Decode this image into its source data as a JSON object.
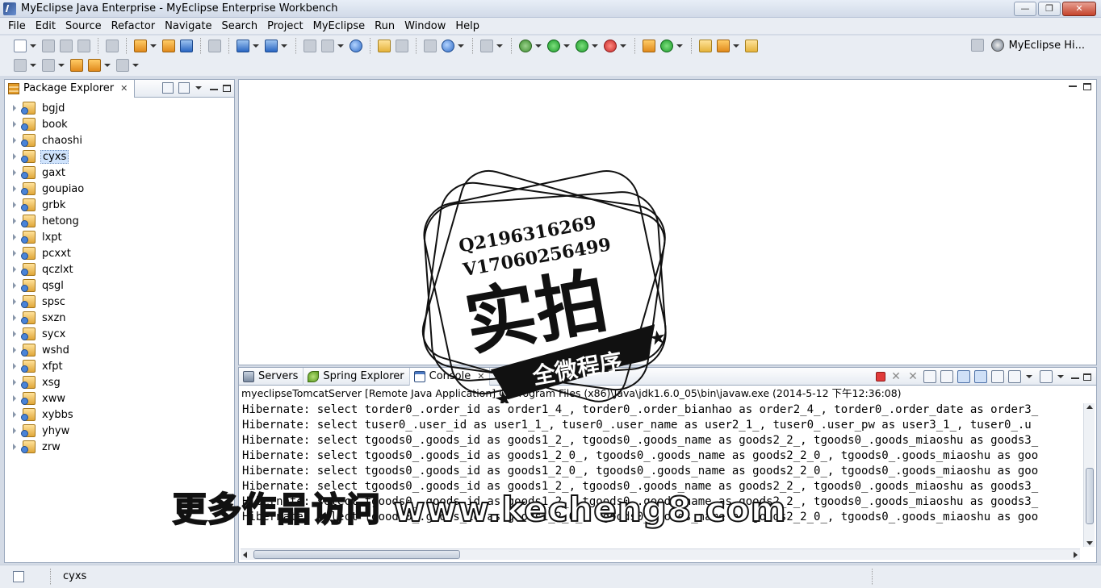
{
  "window": {
    "title": "MyEclipse Java Enterprise - MyEclipse Enterprise Workbench",
    "minimize": "—",
    "restore": "❐",
    "close": "✕"
  },
  "menu": [
    "File",
    "Edit",
    "Source",
    "Refactor",
    "Navigate",
    "Search",
    "Project",
    "MyEclipse",
    "Run",
    "Window",
    "Help"
  ],
  "perspective": {
    "label": "MyEclipse Hi..."
  },
  "package_explorer": {
    "title": "Package Explorer",
    "close": "✕",
    "projects": [
      "bgjd",
      "book",
      "chaoshi",
      "cyxs",
      "gaxt",
      "goupiao",
      "grbk",
      "hetong",
      "lxpt",
      "pcxxt",
      "qczlxt",
      "qsgl",
      "spsc",
      "sxzn",
      "sycx",
      "wshd",
      "xfpt",
      "xsg",
      "xww",
      "xybbs",
      "yhyw",
      "zrw"
    ],
    "selected": "cyxs"
  },
  "bottom_tabs": {
    "servers": "Servers",
    "spring": "Spring Explorer",
    "console": "Console",
    "close": "✕"
  },
  "console": {
    "header": "myeclipseTomcatServer [Remote Java Application] C:\\Program Files (x86)\\Java\\jdk1.6.0_05\\bin\\javaw.exe (2014-5-12 下午12:36:08)",
    "lines": [
      "Hibernate: select torder0_.order_id as order1_4_, torder0_.order_bianhao as order2_4_, torder0_.order_date as order3_",
      "Hibernate: select tuser0_.user_id as user1_1_, tuser0_.user_name as user2_1_, tuser0_.user_pw as user3_1_, tuser0_.u",
      "Hibernate: select tgoods0_.goods_id as goods1_2_, tgoods0_.goods_name as goods2_2_, tgoods0_.goods_miaoshu as goods3_",
      "Hibernate: select tgoods0_.goods_id as goods1_2_0_, tgoods0_.goods_name as goods2_2_0_, tgoods0_.goods_miaoshu as goo",
      "Hibernate: select tgoods0_.goods_id as goods1_2_0_, tgoods0_.goods_name as goods2_2_0_, tgoods0_.goods_miaoshu as goo",
      "Hibernate: select tgoods0_.goods_id as goods1_2_, tgoods0_.goods_name as goods2_2_, tgoods0_.goods_miaoshu as goods3_",
      "Hibernate: select tgoods0_.goods_id as goods1_2_, tgoods0_.goods_name as goods2_2_, tgoods0_.goods_miaoshu as goods3_",
      "Hibernate: select tgoods0_.goods_id as goods1_2_0_, tgoods0_.goods_name as goods2_2_0_, tgoods0_.goods_miaoshu as goo"
    ]
  },
  "statusbar": {
    "text": "cyxs"
  },
  "watermark": {
    "qq": "Q2196316269",
    "wx": "V17060256499",
    "big": "实拍",
    "banner": "全微程序",
    "bottom": "更多作品访问 www.kecheng8.com"
  }
}
